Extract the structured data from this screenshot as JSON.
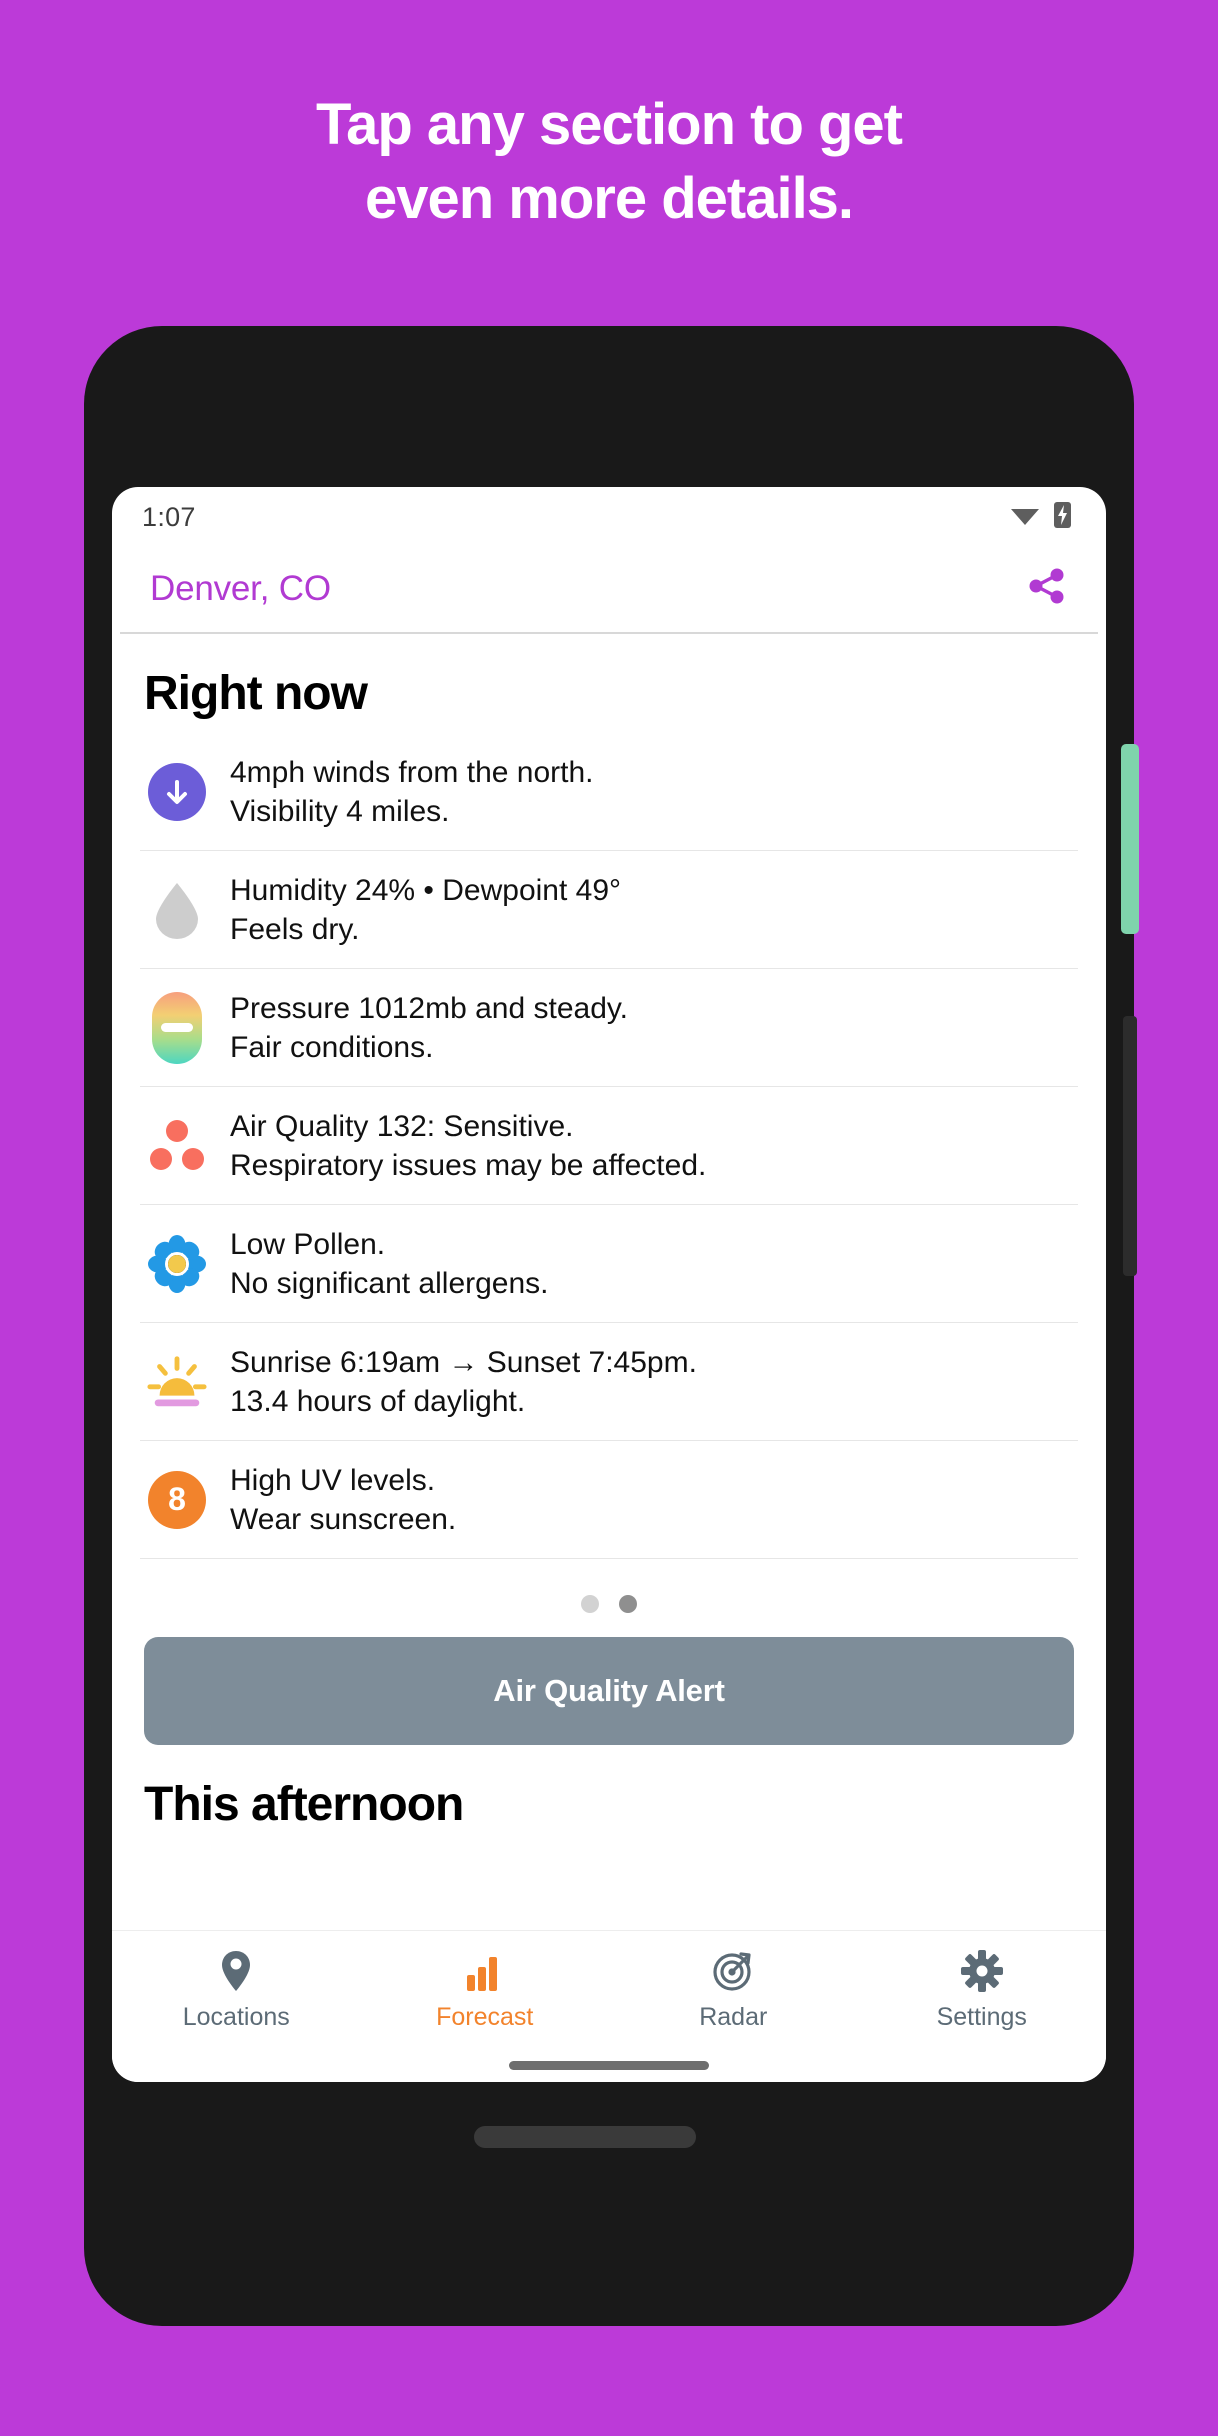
{
  "promo": {
    "line1": "Tap any section to get",
    "line2": "even more details."
  },
  "colors": {
    "background": "#bc3ad8",
    "accent_purple": "#b13ad2",
    "accent_orange": "#f2832c",
    "alert_button": "#7e8d99",
    "wind_icon": "#6c5dd8"
  },
  "statusbar": {
    "time": "1:07",
    "icons": [
      "wifi-icon",
      "battery-charging-icon"
    ]
  },
  "header": {
    "location": "Denver, CO",
    "share_icon": "share-icon"
  },
  "main": {
    "section_title": "Right now",
    "rows": [
      {
        "icon": "wind-direction-icon",
        "line1": "4mph winds from the north.",
        "line2": "Visibility 4 miles."
      },
      {
        "icon": "humidity-droplet-icon",
        "line1": "Humidity 24% • Dewpoint 49°",
        "line2": "Feels dry."
      },
      {
        "icon": "pressure-gauge-icon",
        "line1": "Pressure 1012mb and steady.",
        "line2": "Fair conditions."
      },
      {
        "icon": "air-quality-dots-icon",
        "line1": "Air Quality 132: Sensitive.",
        "line2": "Respiratory issues may be affected."
      },
      {
        "icon": "pollen-flower-icon",
        "line1": "Low Pollen.",
        "line2": "No significant allergens."
      },
      {
        "icon": "sunrise-sunset-icon",
        "line1": "Sunrise 6:19am → Sunset 7:45pm.",
        "line2": "13.4 hours of daylight."
      },
      {
        "icon": "uv-index-icon",
        "icon_value": "8",
        "line1": "High UV levels.",
        "line2": "Wear sunscreen."
      }
    ],
    "pagination": {
      "total": 2,
      "active_index": 1
    },
    "alert_label": "Air Quality Alert",
    "next_section_title": "This afternoon"
  },
  "nav": {
    "items": [
      {
        "label": "Locations",
        "icon": "map-pin-icon",
        "active": false
      },
      {
        "label": "Forecast",
        "icon": "bar-chart-icon",
        "active": true
      },
      {
        "label": "Radar",
        "icon": "radar-target-icon",
        "active": false
      },
      {
        "label": "Settings",
        "icon": "gear-icon",
        "active": false
      }
    ]
  }
}
